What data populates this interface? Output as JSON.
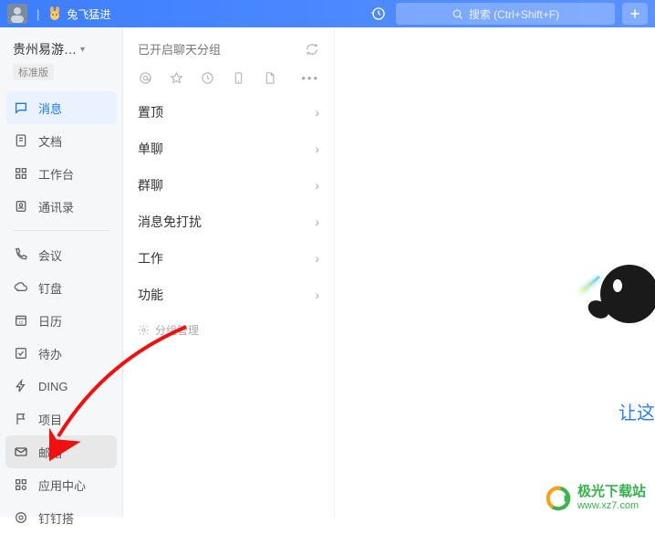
{
  "titlebar": {
    "title": "兔飞猛进",
    "search_placeholder": "搜索 (Ctrl+Shift+F)"
  },
  "sidebar": {
    "org_name": "贵州易游…",
    "org_tag": "标准版",
    "items": [
      {
        "label": "消息"
      },
      {
        "label": "文档"
      },
      {
        "label": "工作台"
      },
      {
        "label": "通讯录"
      },
      {
        "label": "会议"
      },
      {
        "label": "钉盘"
      },
      {
        "label": "日历"
      },
      {
        "label": "待办"
      },
      {
        "label": "DING"
      },
      {
        "label": "项目"
      },
      {
        "label": "邮箱"
      },
      {
        "label": "应用中心"
      },
      {
        "label": "钉钉搭"
      }
    ]
  },
  "midpanel": {
    "header": "已开启聊天分组",
    "groups": [
      {
        "label": "置顶"
      },
      {
        "label": "单聊"
      },
      {
        "label": "群聊"
      },
      {
        "label": "消息免打扰"
      },
      {
        "label": "工作"
      },
      {
        "label": "功能"
      }
    ],
    "manage_label": "分组管理"
  },
  "rightpanel": {
    "partial_text": "让这"
  },
  "watermark": {
    "name": "极光下载站",
    "url": "www.xz7.com"
  }
}
